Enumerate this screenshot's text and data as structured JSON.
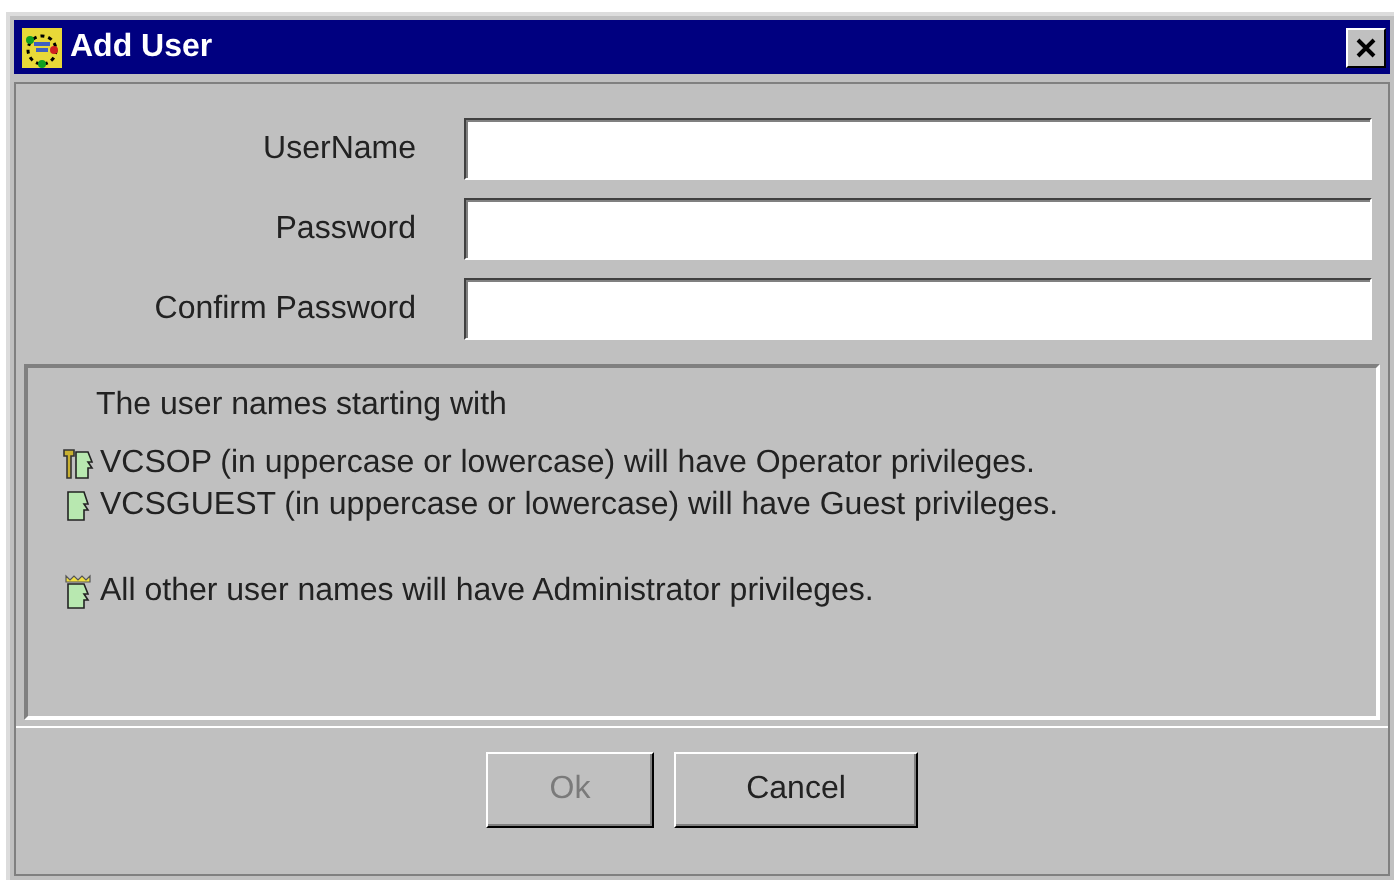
{
  "window": {
    "title": "Add User"
  },
  "fields": [
    {
      "label": "UserName"
    },
    {
      "label": "Password"
    },
    {
      "label": "Confirm Password"
    }
  ],
  "info": {
    "heading": "The user names starting with",
    "lines": [
      {
        "kind": "operator",
        "text": "VCSOP (in uppercase or lowercase) will have Operator privileges."
      },
      {
        "kind": "guest",
        "text": "VCSGUEST (in uppercase or lowercase) will have Guest privileges."
      },
      {
        "kind": "admin",
        "text": "All other user names will have Administrator privileges."
      }
    ]
  },
  "buttons": [
    {
      "label": "Ok",
      "disabled": true
    },
    {
      "label": "Cancel",
      "disabled": false
    }
  ]
}
